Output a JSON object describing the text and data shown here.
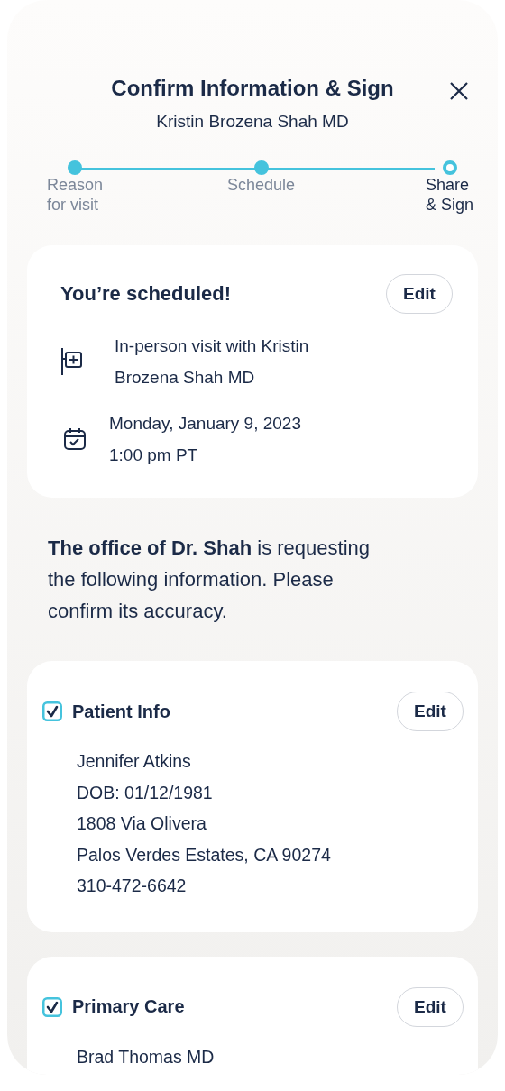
{
  "title": "Confirm Information & Sign",
  "subtitle": "Kristin Brozena Shah MD",
  "steps": [
    {
      "label": "Reason\nfor visit",
      "completed": true,
      "selected": false
    },
    {
      "label": "Schedule",
      "completed": true,
      "selected": false
    },
    {
      "label": "Share\n& Sign",
      "completed": false,
      "selected": true
    }
  ],
  "appointment": {
    "heading": "You’re scheduled!",
    "edit": "Edit",
    "details": [
      {
        "kind": "visit",
        "text": "In-person visit with Kristin\nBrozena Shah MD"
      },
      {
        "kind": "date",
        "text": "Monday, January 9, 2023\n1:00 pm PT"
      }
    ]
  },
  "intro": "**The office of Dr. Shah** is requesting the following information. Please confirm its accuracy.",
  "sections": [
    {
      "title": "Patient Info",
      "checked": true,
      "edit": "Edit",
      "lines": [
        "Jennifer Atkins",
        "DOB: 01/12/1981",
        "1808 Via Olivera",
        "Palos Verdes Estates, CA 90274",
        "310-472-6642"
      ]
    },
    {
      "title": "Primary Care",
      "checked": true,
      "edit": "Edit",
      "lines": [
        "Brad Thomas MD"
      ]
    }
  ]
}
